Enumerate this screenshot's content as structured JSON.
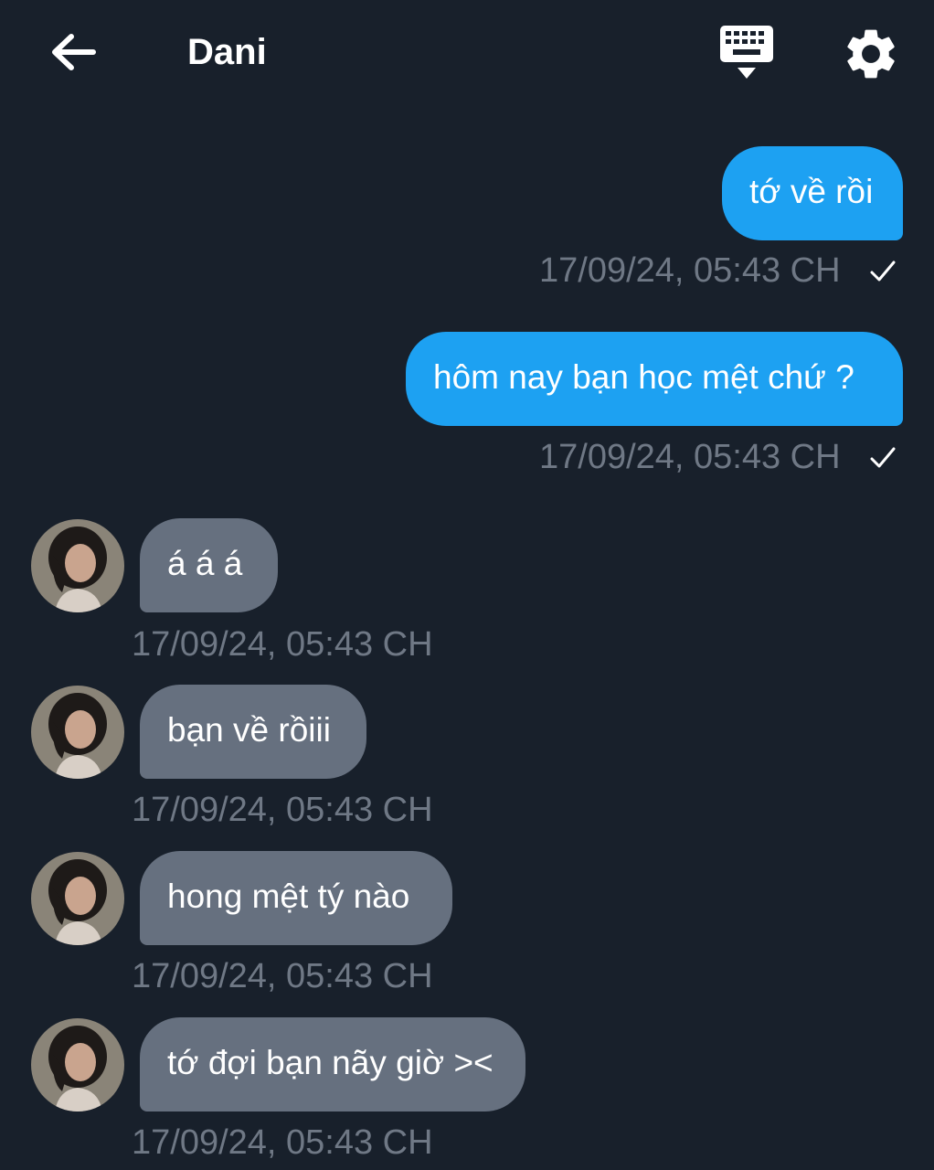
{
  "header": {
    "back_icon": "arrow-left-icon",
    "title": "Dani",
    "keyboard_icon": "keyboard-icon",
    "settings_icon": "gear-icon"
  },
  "colors": {
    "background": "#18202b",
    "outgoing_bubble": "#1da1f2",
    "incoming_bubble": "#66707f",
    "timestamp": "#6f7885"
  },
  "messages": [
    {
      "direction": "outgoing",
      "text": "tớ về rồi",
      "time": "17/09/24, 05:43 CH",
      "status": "sent-check-icon"
    },
    {
      "direction": "outgoing",
      "text": "hôm nay bạn học mệt chứ ?",
      "time": "17/09/24, 05:43 CH",
      "status": "sent-check-icon"
    },
    {
      "direction": "incoming",
      "text": "á á á",
      "time": "17/09/24, 05:43 CH"
    },
    {
      "direction": "incoming",
      "text": "bạn về rồiii",
      "time": "17/09/24, 05:43 CH"
    },
    {
      "direction": "incoming",
      "text": "hong mệt tý nào",
      "time": "17/09/24, 05:43 CH"
    },
    {
      "direction": "incoming",
      "text": "tớ đợi bạn nãy giờ ><",
      "time": "17/09/24, 05:43 CH"
    }
  ]
}
